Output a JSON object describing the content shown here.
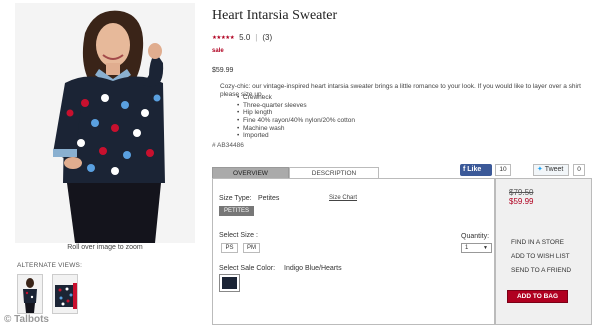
{
  "product": {
    "title": "Heart Intarsia Sweater",
    "rating_stars": "★★★★★",
    "rating_value": "5.0",
    "review_count": "(3)",
    "sale_label": "sale",
    "price": "$59.99",
    "description": "Cozy-chic: our vintage-inspired heart intarsia sweater brings a little romance to your look. If you would like to layer over a shirt please size up.",
    "features": [
      "Crewneck",
      "Three-quarter sleeves",
      "Hip length",
      "Fine 40% rayon/40% nylon/20% cotton",
      "Machine wash",
      "Imported"
    ],
    "sku": "# AB34486"
  },
  "gallery": {
    "zoom_hint": "Roll over image to zoom",
    "alternate_label": "ALTERNATE VIEWS:",
    "watermark": "© Talbots"
  },
  "tabs": [
    {
      "label": "OVERVIEW",
      "active": true
    },
    {
      "label": "DESCRIPTION",
      "active": false
    }
  ],
  "social": {
    "like_label": "Like",
    "like_count": "10",
    "tweet_label": "Tweet",
    "tweet_count": "0"
  },
  "options": {
    "size_type_label": "Size Type:",
    "size_type_value": "Petites",
    "size_chart_label": "Size Chart",
    "size_type_button": "PETITES",
    "select_size_label": "Select Size :",
    "sizes": [
      "PS",
      "PM"
    ],
    "quantity_label": "Quantity:",
    "quantity_value": "1",
    "color_label": "Select Sale Color:",
    "color_value": "Indigo Blue/Hearts",
    "swatch_color": "#1b2435"
  },
  "purchase": {
    "old_price": "$79.50",
    "new_price": "$59.99",
    "find_store": "FIND IN A STORE",
    "add_wishlist": "ADD TO WISH LIST",
    "send_friend": "SEND TO A FRIEND",
    "add_to_bag": "ADD TO BAG"
  },
  "colors": {
    "accent": "#b00020",
    "facebook": "#3b5998",
    "tab_active": "#aaaaaa"
  }
}
